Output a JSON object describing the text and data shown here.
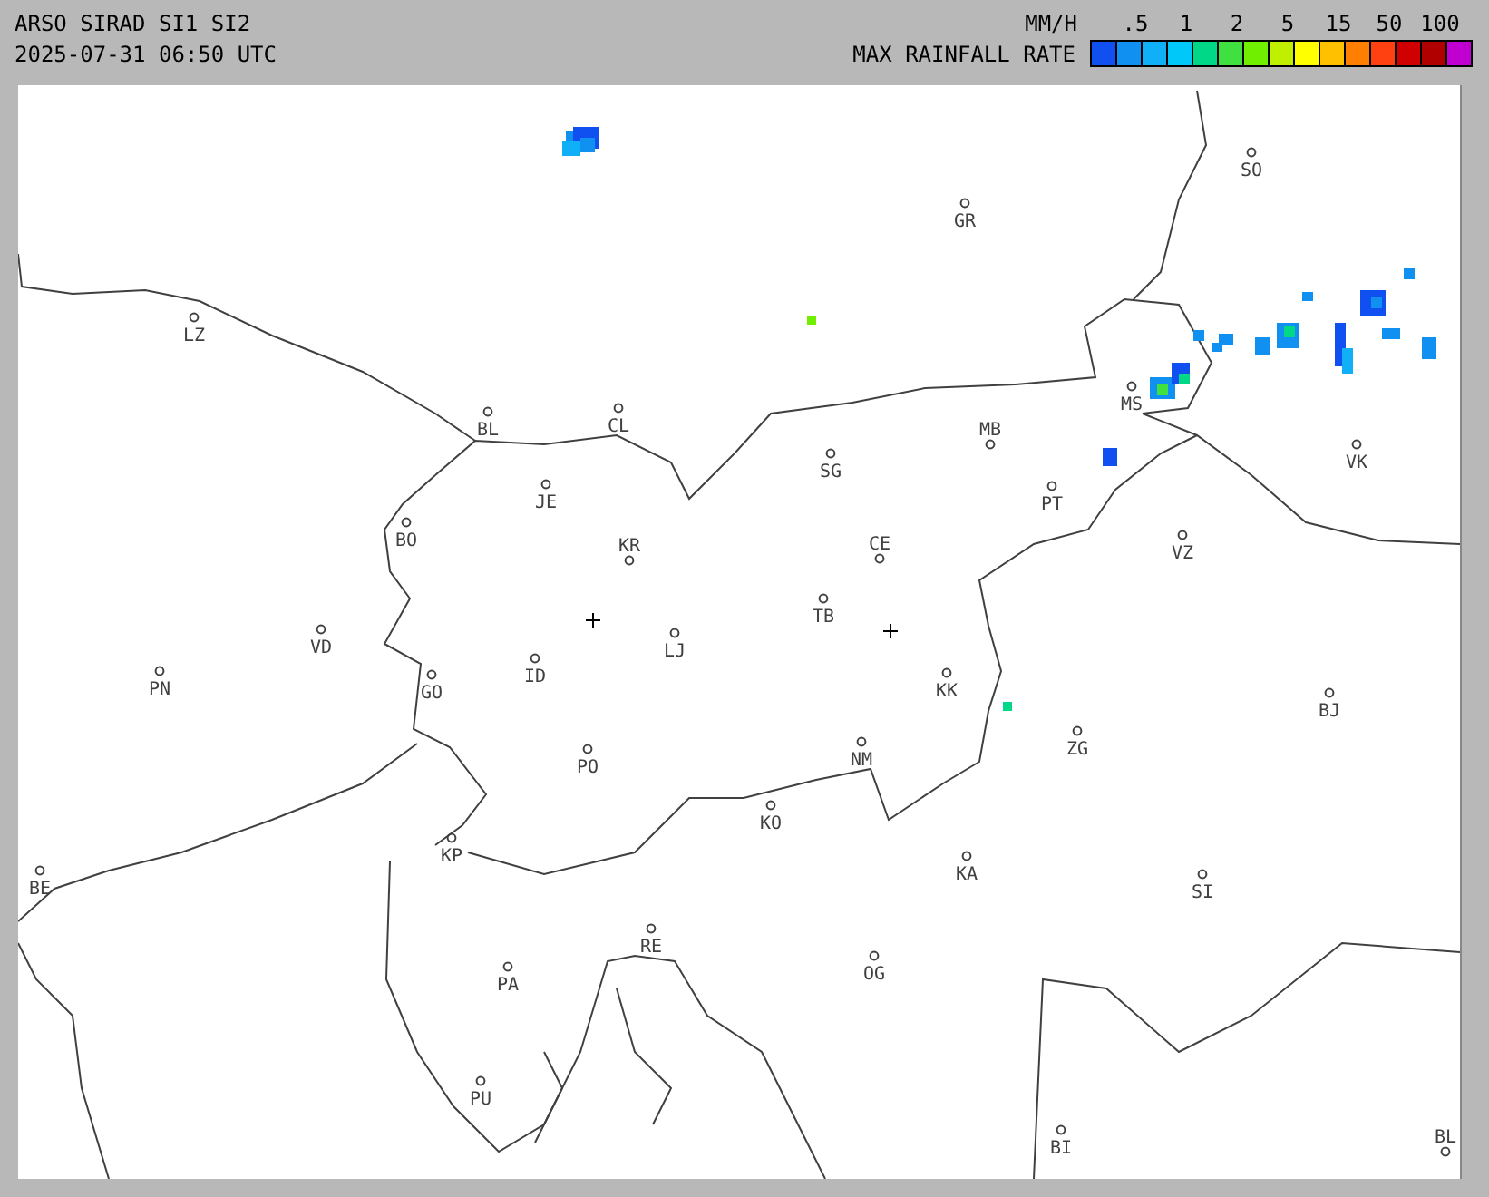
{
  "header": {
    "title": "ARSO SIRAD SI1 SI2",
    "timestamp": "2025-07-31 06:50 UTC"
  },
  "legend": {
    "unit": "MM/H",
    "title": "MAX RAINFALL RATE",
    "ticks": [
      ".5",
      "1",
      "2",
      "5",
      "15",
      "50",
      "100"
    ],
    "swatches": [
      {
        "color": "#1050f0"
      },
      {
        "color": "#1090f0"
      },
      {
        "color": "#10b0f8"
      },
      {
        "color": "#00c8f8"
      },
      {
        "color": "#00d888"
      },
      {
        "color": "#40e040"
      },
      {
        "color": "#70f000"
      },
      {
        "color": "#c0f000"
      },
      {
        "color": "#ffff00"
      },
      {
        "color": "#ffc000"
      },
      {
        "color": "#ff8000"
      },
      {
        "color": "#ff4010"
      },
      {
        "color": "#d00000"
      },
      {
        "color": "#b00000"
      },
      {
        "color": "#c000d0"
      }
    ]
  },
  "cities": [
    {
      "label": "SO"
    },
    {
      "label": "GR"
    },
    {
      "label": "LZ"
    },
    {
      "label": "BL"
    },
    {
      "label": "CL"
    },
    {
      "label": "SG"
    },
    {
      "label": "MB"
    },
    {
      "label": "MS"
    },
    {
      "label": "VK"
    },
    {
      "label": "JE"
    },
    {
      "label": "PT"
    },
    {
      "label": "BO"
    },
    {
      "label": "KR"
    },
    {
      "label": "CE"
    },
    {
      "label": "VZ"
    },
    {
      "label": "TB"
    },
    {
      "label": "LJ"
    },
    {
      "label": "VD"
    },
    {
      "label": "PN"
    },
    {
      "label": "ID"
    },
    {
      "label": "GO"
    },
    {
      "label": "KK"
    },
    {
      "label": "BJ"
    },
    {
      "label": "ZG"
    },
    {
      "label": "NM"
    },
    {
      "label": "PO"
    },
    {
      "label": "KO"
    },
    {
      "label": "KP"
    },
    {
      "label": "KA"
    },
    {
      "label": "SI"
    },
    {
      "label": "BE"
    },
    {
      "label": "RE"
    },
    {
      "label": "OG"
    },
    {
      "label": "PA"
    },
    {
      "label": "PU"
    },
    {
      "label": "BI"
    },
    {
      "label": "BL"
    }
  ]
}
